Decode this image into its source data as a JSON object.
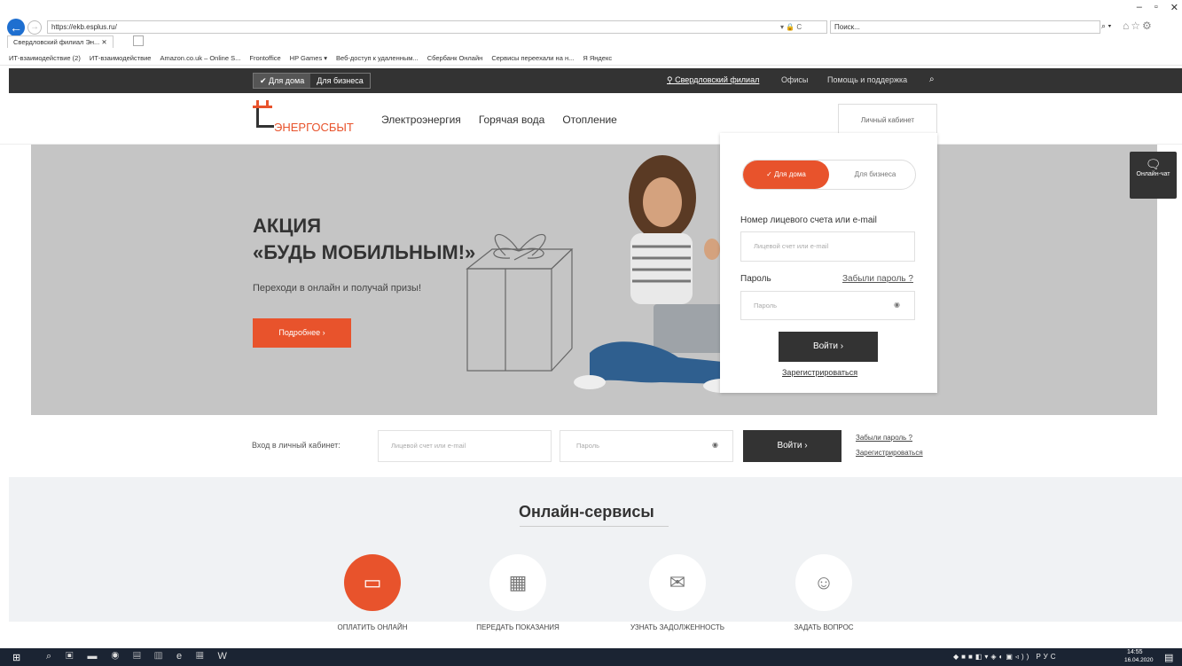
{
  "window": {
    "minimize": "–",
    "restore": "▫",
    "close": "✕"
  },
  "browser": {
    "url": "https://ekb.esplus.ru/",
    "address_icons": "▾ 🔒 C",
    "search_placeholder": "Поиск...",
    "search_icon": "⌕ ▾",
    "tab_title": "Свердловский филиал Эн... ✕",
    "favorites": [
      "ИТ-взаимодействие (2)",
      "ИТ-взаимодействие",
      "Amazon.co.uk – Online S...",
      "Frontoffice",
      "HP Games ▾",
      "Веб-доступ к удаленным...",
      "Сбербанк Онлайн",
      "Сервисы переехали на н...",
      "Я Яндекс"
    ]
  },
  "topbar": {
    "home_label": "✔ Для дома",
    "business_label": "Для бизнеса",
    "region": "Свердловский филиал",
    "offices": "Офисы",
    "help": "Помощь и поддержка",
    "search_icon": "⌕"
  },
  "header": {
    "logo_text": "ЭНЕРГОСБЫТ",
    "nav": [
      "Электроэнергия",
      "Горячая вода",
      "Отопление"
    ],
    "account_tab": "Личный кабинет"
  },
  "hero": {
    "title_line1": "АКЦИЯ",
    "title_line2": "«БУДЬ МОБИЛЬНЫМ!»",
    "subtitle": "Переходи в онлайн и получай призы!",
    "button": "Подробнее  ›"
  },
  "chat": {
    "label": "Онлайн-чат"
  },
  "login_panel": {
    "home": "✓  Для дома",
    "business": "Для бизнеса",
    "account_label": "Номер лицевого счета или e-mail",
    "account_placeholder": "Лицевой счет или e-mail",
    "password_label": "Пароль",
    "forgot": "Забыли пароль ?",
    "password_placeholder": "Пароль",
    "login_button": "Войти  ›",
    "register": "Зарегистрироваться"
  },
  "login_row": {
    "label": "Вход в личный кабинет:",
    "account_placeholder": "Лицевой счет или e-mail",
    "password_placeholder": "Пароль",
    "login_button": "Войти  ›",
    "forgot": "Забыли пароль ?",
    "register": "Зарегистрироваться"
  },
  "services": {
    "title": "Онлайн-сервисы",
    "items": [
      {
        "label": "ОПЛАТИТЬ ОНЛАЙН",
        "icon": "credit-card"
      },
      {
        "label": "ПЕРЕДАТЬ ПОКАЗАНИЯ",
        "icon": "meter"
      },
      {
        "label": "УЗНАТЬ ЗАДОЛЖЕННОСТЬ",
        "icon": "envelope-ruble"
      },
      {
        "label": "ЗАДАТЬ ВОПРОС",
        "icon": "operator"
      }
    ]
  },
  "taskbar": {
    "lang": "РУС",
    "time": "14:55",
    "date": "16.04.2020"
  },
  "colors": {
    "accent": "#e8532c",
    "dark": "#333333",
    "hero_bg": "#c5c5c5"
  }
}
